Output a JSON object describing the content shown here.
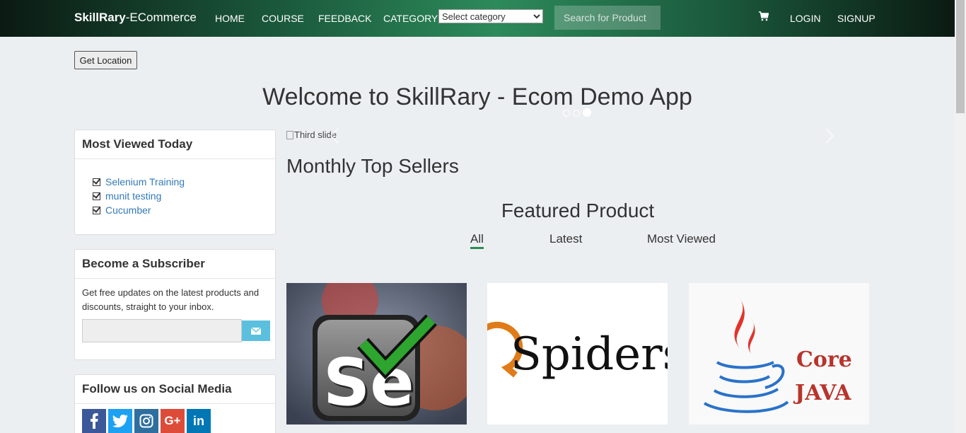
{
  "navbar": {
    "brand_bold": "SkillRary",
    "brand_rest": "-ECommerce",
    "links": [
      "HOME",
      "COURSE",
      "FEEDBACK",
      "CATEGORY"
    ],
    "category_select": "Select category",
    "search_placeholder": "Search for Product",
    "login": "LOGIN",
    "signup": "SIGNUP"
  },
  "get_location": "Get Location",
  "welcome": "Welcome to SkillRary - Ecom Demo App",
  "most_viewed": {
    "title": "Most Viewed Today",
    "items": [
      "Selenium Training",
      "munit testing",
      "Cucumber"
    ]
  },
  "subscriber": {
    "title": "Become a Subscriber",
    "text": "Get free updates on the latest products and discounts, straight to your inbox."
  },
  "social": {
    "title": "Follow us on Social Media",
    "icons": [
      "facebook-icon",
      "twitter-icon",
      "instagram-icon",
      "google-plus-icon",
      "linkedin-icon"
    ],
    "colors": [
      "#3b5998",
      "#1da1f2",
      "#2f6f9f",
      "#dd4b39",
      "#0077b5"
    ]
  },
  "carousel": {
    "alt_text": "Third slide",
    "caption": "Monthly Top Sellers",
    "active_index": 2,
    "count": 3
  },
  "featured": {
    "title": "Featured Product",
    "tabs": [
      "All",
      "Latest",
      "Most Viewed"
    ],
    "active_tab": "All",
    "products": [
      {
        "name": "Selenium",
        "logo_text": "Se"
      },
      {
        "name": "QSpiders",
        "logo_text": "QSpiders"
      },
      {
        "name": "Core Java",
        "logo_line1": "Core",
        "logo_line2": "JAVA"
      }
    ]
  },
  "colors": {
    "accent": "#2e8b57",
    "link": "#337ab7",
    "subscribe_button": "#5bc0de"
  }
}
